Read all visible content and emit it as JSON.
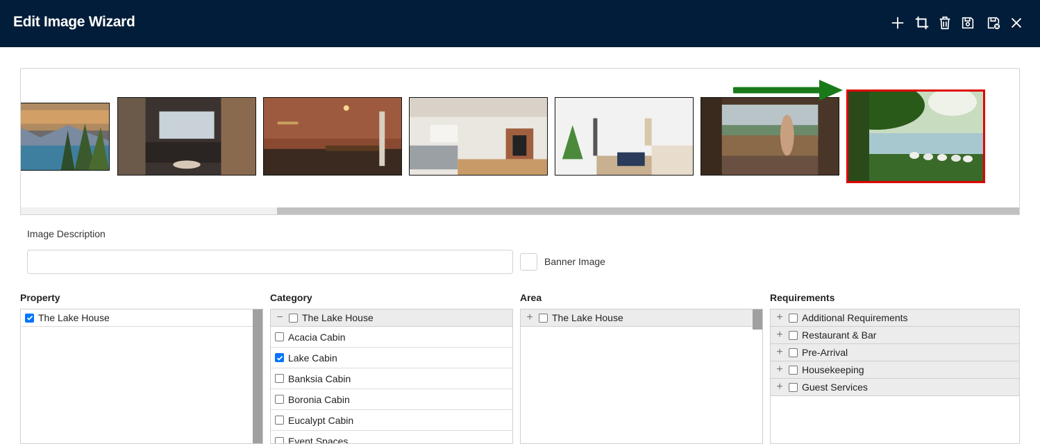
{
  "window": {
    "title": "Edit Image Wizard"
  },
  "toolbar": [
    {
      "icon": "plus-icon"
    },
    {
      "icon": "crop-icon"
    },
    {
      "icon": "trash-icon"
    },
    {
      "icon": "save-icon"
    },
    {
      "icon": "save-close-icon"
    },
    {
      "icon": "close-icon"
    }
  ],
  "gallery": {
    "images": [
      {
        "subject": "mountain lake landscape",
        "selected": false
      },
      {
        "subject": "wooden living room",
        "selected": false
      },
      {
        "subject": "brick wall kitchen",
        "selected": false
      },
      {
        "subject": "lounge with fireplace",
        "selected": false
      },
      {
        "subject": "bright bedroom",
        "selected": false
      },
      {
        "subject": "woman on balcony",
        "selected": false
      },
      {
        "subject": "geese by lake",
        "selected": true
      }
    ],
    "highlight_color": "#e00000",
    "arrow_color": "#1a7a1a"
  },
  "form": {
    "description_label": "Image Description",
    "description_value": "",
    "banner_label": "Banner Image",
    "banner_checked": false
  },
  "property": {
    "title": "Property",
    "items": [
      {
        "label": "The Lake House",
        "checked": true
      }
    ]
  },
  "category": {
    "title": "Category",
    "group": {
      "expander": "−",
      "label": "The Lake House",
      "checked": false
    },
    "items": [
      {
        "label": "Acacia Cabin",
        "checked": false
      },
      {
        "label": "Lake Cabin",
        "checked": true
      },
      {
        "label": "Banksia Cabin",
        "checked": false
      },
      {
        "label": "Boronia Cabin",
        "checked": false
      },
      {
        "label": "Eucalypt Cabin",
        "checked": false
      },
      {
        "label": "Event Spaces",
        "checked": false
      }
    ]
  },
  "area": {
    "title": "Area",
    "group": {
      "expander": "+",
      "label": "The Lake House",
      "checked": false
    }
  },
  "requirements": {
    "title": "Requirements",
    "groups": [
      {
        "expander": "+",
        "label": "Additional Requirements",
        "checked": false
      },
      {
        "expander": "+",
        "label": "Restaurant & Bar",
        "checked": false
      },
      {
        "expander": "+",
        "label": "Pre-Arrival",
        "checked": false
      },
      {
        "expander": "+",
        "label": "Housekeeping",
        "checked": false
      },
      {
        "expander": "+",
        "label": "Guest Services",
        "checked": false
      }
    ]
  },
  "colors": {
    "header_bg": "#021d39",
    "checkbox_checked": "#0075ff"
  }
}
